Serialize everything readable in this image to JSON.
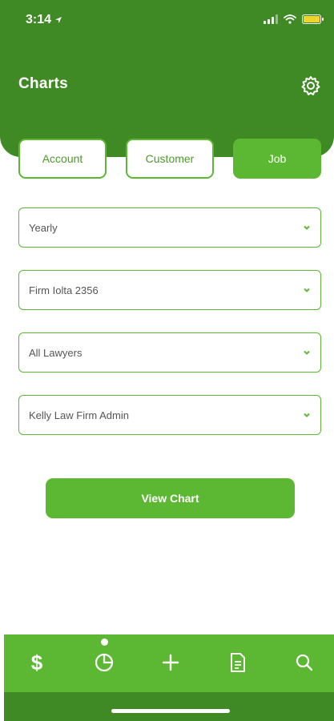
{
  "status_bar": {
    "time": "3:14"
  },
  "header": {
    "title": "Charts"
  },
  "tabs": [
    {
      "label": "Account",
      "active": false
    },
    {
      "label": "Customer",
      "active": false
    },
    {
      "label": "Job",
      "active": true
    }
  ],
  "filters": {
    "period": "Yearly",
    "account": "Firm Iolta 2356",
    "lawyer": "All Lawyers",
    "admin": "Kelly Law Firm Admin"
  },
  "view_button": {
    "label": "View Chart"
  },
  "bottom_nav": {
    "items": [
      "dollar-icon",
      "pie-chart-icon",
      "plus-icon",
      "document-icon",
      "search-icon"
    ],
    "active": "pie-chart-icon"
  },
  "colors": {
    "dark_green": "#3f8a24",
    "green": "#5cb832",
    "battery": "#f2d52c"
  }
}
